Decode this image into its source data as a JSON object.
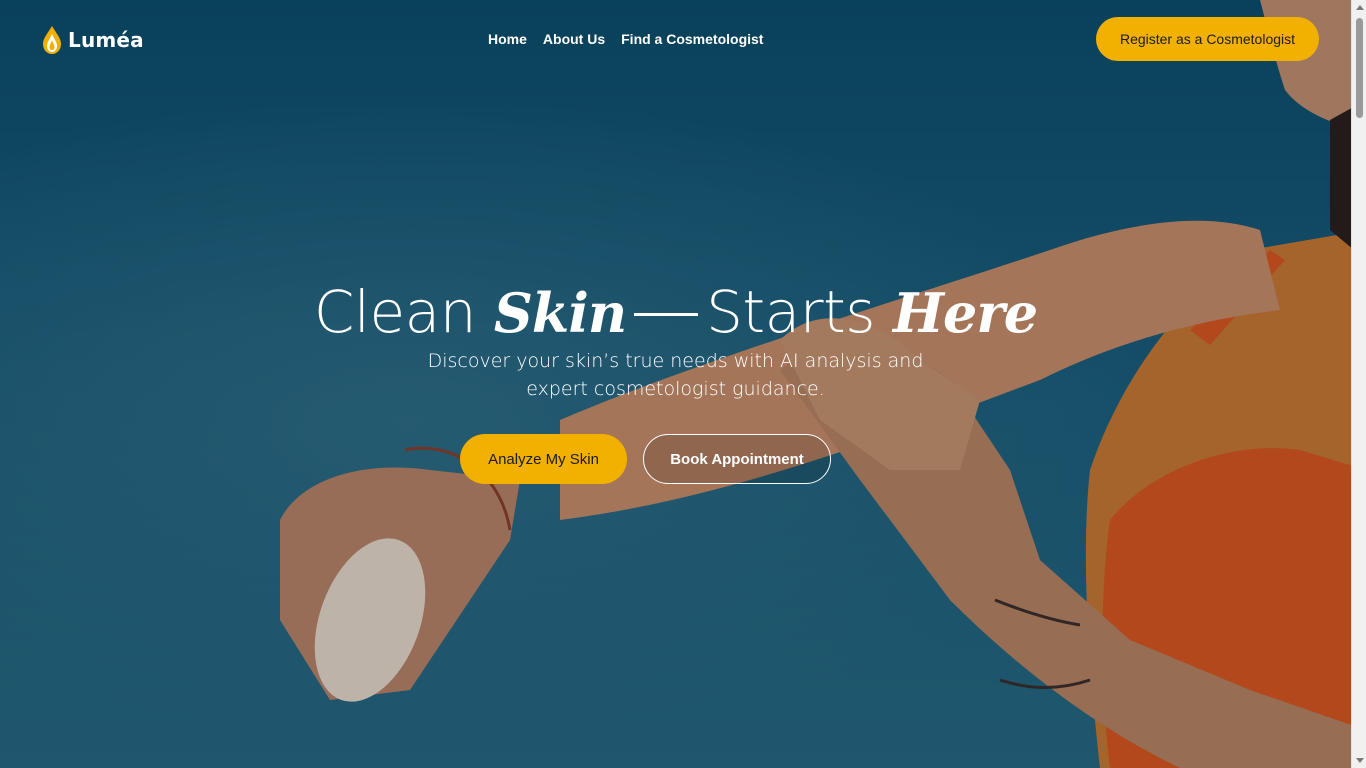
{
  "brand": {
    "name": "Luméa",
    "logo_icon": "drop-flame-icon",
    "logo_colors": {
      "gold": "#f2b100",
      "white": "#ffffff"
    }
  },
  "nav": {
    "links": [
      {
        "label": "Home"
      },
      {
        "label": "About Us"
      },
      {
        "label": "Find a Cosmetologist"
      }
    ],
    "register_label": "Register as a Cosmetologist"
  },
  "hero": {
    "headline": {
      "word1": "Clean",
      "word2": "Skin",
      "word3": "Starts",
      "word4": "Here"
    },
    "subtitle": "Discover your skin’s true needs with AI analysis and expert cosmetologist guidance.",
    "primary_cta": "Analyze My Skin",
    "secondary_cta": "Book Appointment"
  },
  "colors": {
    "accent": "#f2b100",
    "background": "#0f4a66",
    "text": "#ffffff"
  }
}
